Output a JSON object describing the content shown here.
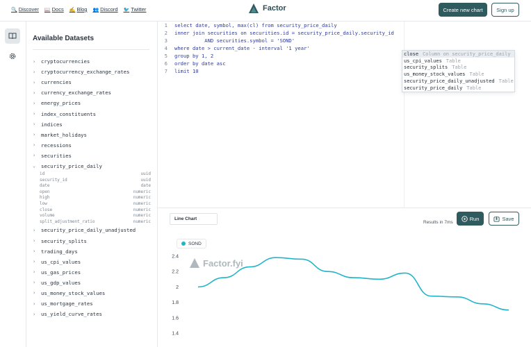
{
  "topnav": {
    "links": [
      {
        "label": "Discover",
        "icon": "magnifier-icon"
      },
      {
        "label": "Docs",
        "icon": "book-icon"
      },
      {
        "label": "Blog",
        "icon": "pencil-icon"
      },
      {
        "label": "Discord",
        "icon": "people-icon"
      },
      {
        "label": "Twitter",
        "icon": "bird-icon"
      }
    ],
    "brand": "Factor",
    "create_label": "Create new chart",
    "signup_label": "Sign up"
  },
  "sidebar": {
    "title": "Available Datasets",
    "datasets_before": [
      "cryptocurrencies",
      "cryptocurrency_exchange_rates",
      "currencies",
      "currency_exchange_rates",
      "energy_prices",
      "index_constituents",
      "indices",
      "market_holidays",
      "recessions",
      "securities"
    ],
    "expanded": {
      "name": "security_price_daily",
      "columns": [
        {
          "name": "id",
          "type": "uuid"
        },
        {
          "name": "security_id",
          "type": "uuid"
        },
        {
          "name": "date",
          "type": "date"
        },
        {
          "name": "open",
          "type": "numeric"
        },
        {
          "name": "high",
          "type": "numeric"
        },
        {
          "name": "low",
          "type": "numeric"
        },
        {
          "name": "close",
          "type": "numeric"
        },
        {
          "name": "volume",
          "type": "numeric"
        },
        {
          "name": "split_adjustment_ratio",
          "type": "numeric"
        }
      ]
    },
    "datasets_after": [
      "security_price_daily_unadjusted",
      "security_splits",
      "trading_days",
      "us_cpi_values",
      "us_gas_prices",
      "us_gdp_values",
      "us_money_stock_values",
      "us_mortgage_rates",
      "us_yield_curve_rates"
    ]
  },
  "editor": {
    "lines": [
      {
        "n": "1",
        "text": "select date, symbol, max(cl) from security_price_daily"
      },
      {
        "n": "2",
        "text": "inner join securities on securities.id = security_price_daily.security_id"
      },
      {
        "n": "3",
        "text": "          AND securities.symbol = 'SOND'"
      },
      {
        "n": "4",
        "text": "where date > current_date - interval '1 year'"
      },
      {
        "n": "5",
        "text": "group by 1, 2"
      },
      {
        "n": "6",
        "text": "order by date asc"
      },
      {
        "n": "7",
        "text": "limit 10"
      }
    ],
    "autocomplete": [
      {
        "name": "close",
        "detail": "Column on security_price_daily"
      },
      {
        "name": "us_cpi_values",
        "detail": "Table"
      },
      {
        "name": "security_splits",
        "detail": "Table"
      },
      {
        "name": "us_money_stock_values",
        "detail": "Table"
      },
      {
        "name": "security_price_daily_unadjusted",
        "detail": "Table"
      },
      {
        "name": "security_price_daily",
        "detail": "Table"
      }
    ]
  },
  "toolbar": {
    "chart_type": "Line Chart",
    "results": "Results in 7ms",
    "run_label": "Run",
    "save_label": "Save"
  },
  "chart_data": {
    "type": "line",
    "series": [
      {
        "name": "SOND",
        "color": "#1fb5c8",
        "values": [
          2.0,
          2.12,
          2.26,
          2.38,
          2.36,
          2.2,
          2.12,
          2.1,
          2.18,
          1.88,
          1.87,
          1.78,
          1.7
        ]
      }
    ],
    "yticks": [
      2.4,
      2.2,
      2,
      1.8,
      1.6,
      1.4
    ],
    "ylim": [
      1.4,
      2.4
    ],
    "watermark": "Factor.fyi",
    "grid": false,
    "legend": "top-left"
  }
}
